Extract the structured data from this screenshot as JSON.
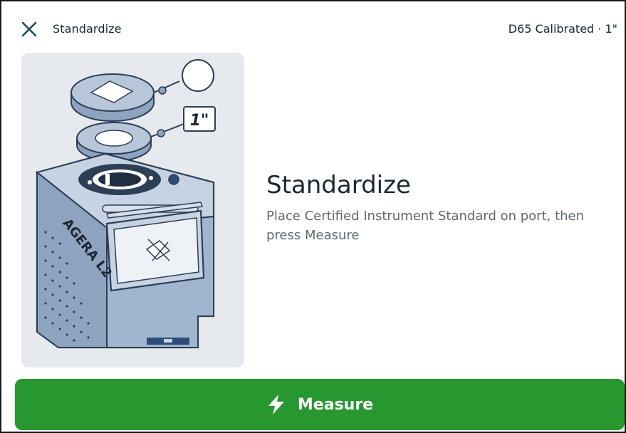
{
  "header": {
    "close_icon": "close-icon",
    "title": "Standardize",
    "status": "D65 Calibrated · 1\""
  },
  "illustration": {
    "aperture_label": "1\"",
    "device_name": "AGERA L2",
    "icon": "instrument-illustration"
  },
  "content": {
    "title": "Standardize",
    "instruction": "Place Certified Instrument Standard on port, then press Measure"
  },
  "measure_button": {
    "label": "Measure",
    "icon": "lightning-bolt-icon",
    "color": "#27972f"
  },
  "colors": {
    "accent": "#27972f",
    "illustration_bg": "#e6eaee",
    "device_blue": "#8ea3bf",
    "close_icon": "#1b4a5e"
  }
}
